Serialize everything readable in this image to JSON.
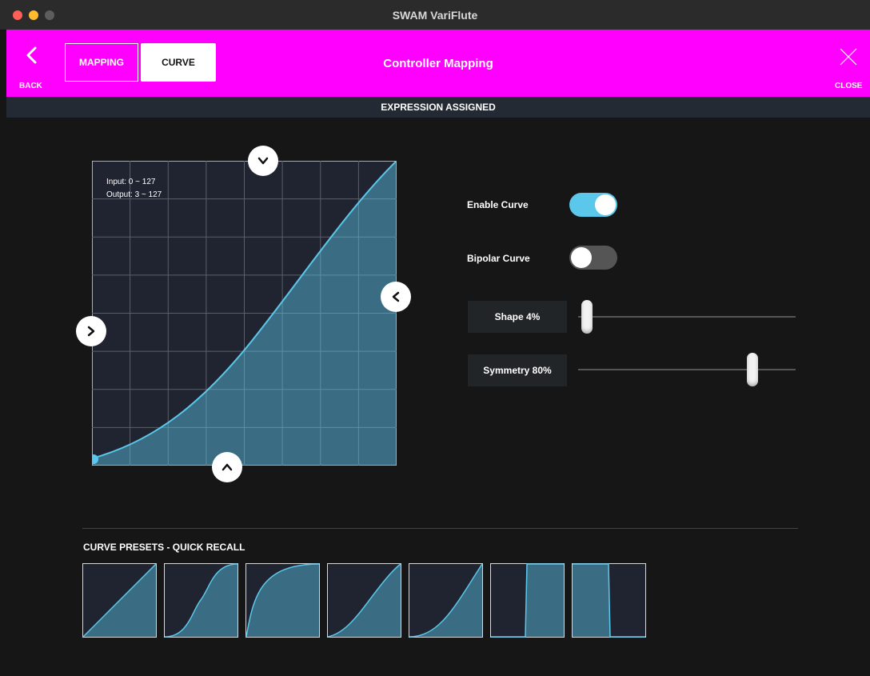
{
  "window": {
    "title": "SWAM VariFlute"
  },
  "header": {
    "back_label": "BACK",
    "tabs": [
      {
        "label": "MAPPING",
        "active": false
      },
      {
        "label": "CURVE",
        "active": true
      }
    ],
    "title": "Controller Mapping",
    "close_label": "CLOSE",
    "background_color": "#ff00ff"
  },
  "status_bar": {
    "text": "EXPRESSION ASSIGNED"
  },
  "curve_editor": {
    "input_range": "Input: 0 ~ 127",
    "output_range": "Output: 3 ~ 127",
    "curve_color": "#5bc8eb"
  },
  "controls": {
    "enable_curve": {
      "label": "Enable Curve",
      "on": true
    },
    "bipolar_curve": {
      "label": "Bipolar Curve",
      "on": false
    },
    "shape": {
      "label": "Shape 4%",
      "value": 4
    },
    "symmetry": {
      "label": "Symmetry 80%",
      "value": 80
    }
  },
  "presets": {
    "title": "CURVE PRESETS - QUICK RECALL",
    "items": [
      "linear",
      "steep-s-curve",
      "exponential-rise",
      "gentle-s-curve",
      "ease-in",
      "step-left",
      "step-right"
    ]
  },
  "colors": {
    "accent": "#5bc8eb",
    "header": "#ff00ff",
    "background": "#161616",
    "graph_bg": "#1f2430"
  }
}
